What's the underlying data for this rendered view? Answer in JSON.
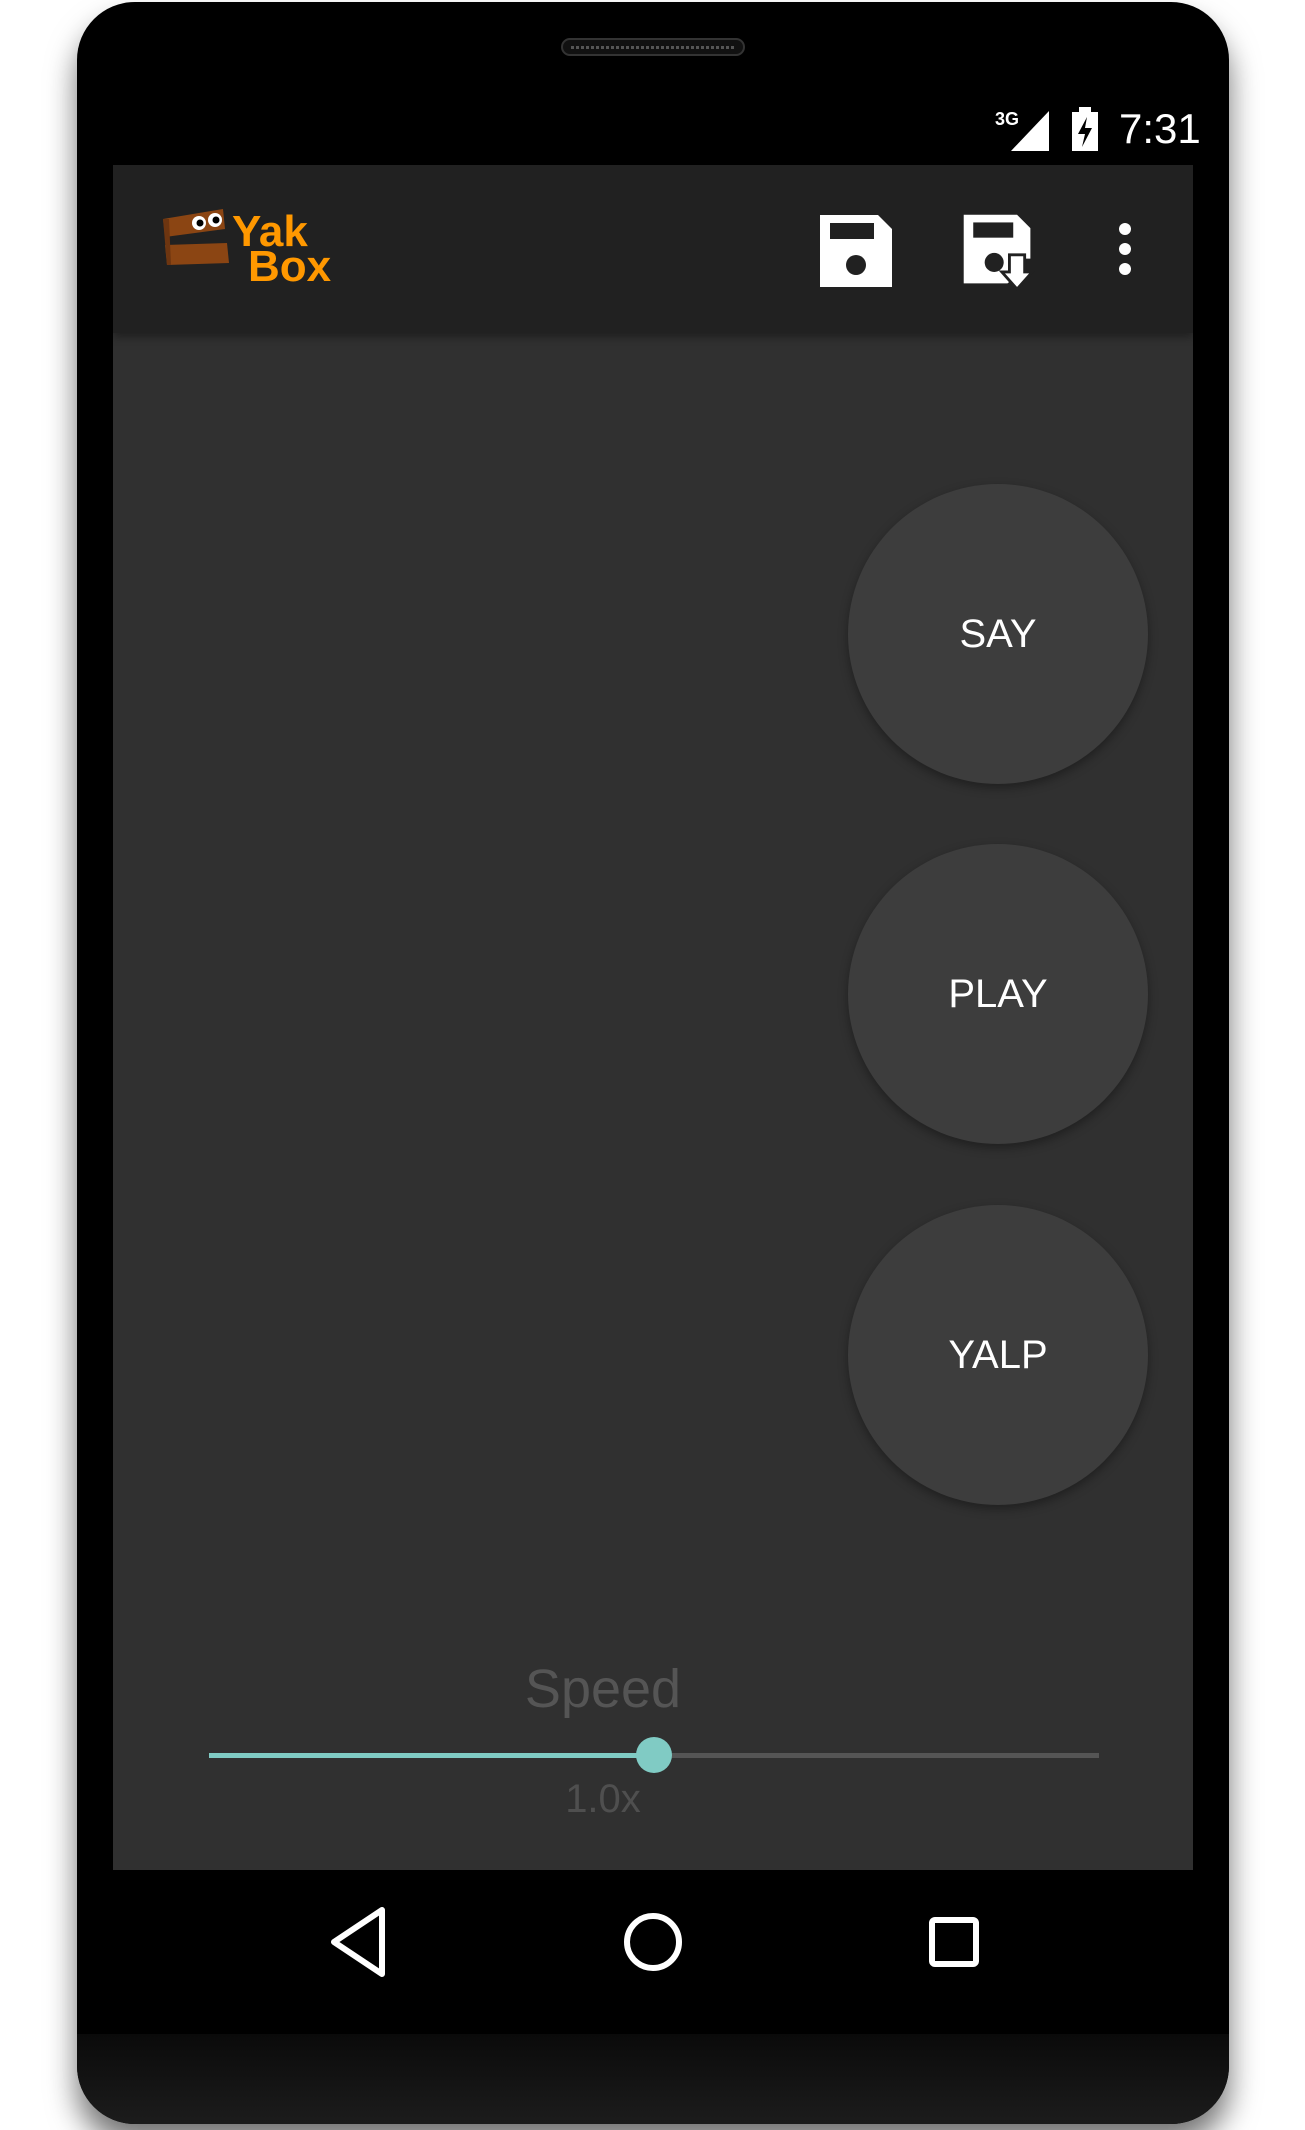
{
  "status_bar": {
    "network": "3G",
    "time": "7:31",
    "icons": [
      "signal-icon",
      "battery-charging-icon"
    ]
  },
  "toolbar": {
    "logo_line1": "Yak",
    "logo_line2": "Box",
    "actions": [
      "save-icon",
      "save-as-icon",
      "overflow-menu-icon"
    ]
  },
  "buttons": {
    "say": "SAY",
    "play": "PLAY",
    "yalp": "YALP"
  },
  "speed": {
    "label": "Speed",
    "value_label": "1.0x",
    "fraction": 0.5
  },
  "nav_bar": {
    "icons": [
      "back-icon",
      "home-icon",
      "recents-icon"
    ]
  },
  "colors": {
    "accent": "#80cbc4",
    "brand": "#ff9800",
    "background": "#303030",
    "toolbar": "#212121",
    "button": "#3d3d3d"
  }
}
